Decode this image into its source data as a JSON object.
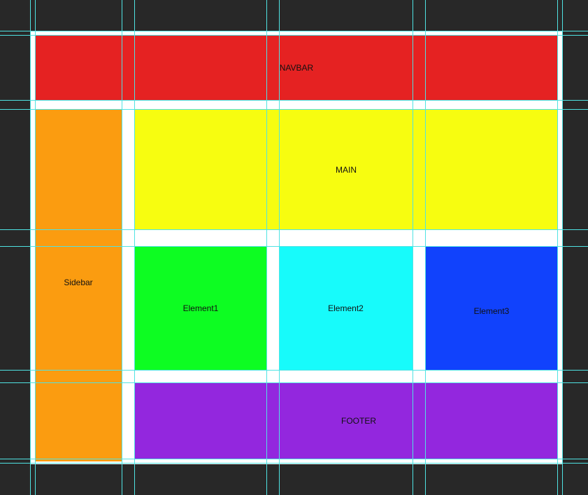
{
  "layout": {
    "navbar": {
      "label": "NAVBAR",
      "color": "#e52222"
    },
    "sidebar": {
      "label": "Sidebar",
      "color": "#fb9c10"
    },
    "main": {
      "label": "MAIN",
      "color": "#f7fd10"
    },
    "elements": [
      {
        "label": "Element1",
        "color": "#0dfd22"
      },
      {
        "label": "Element2",
        "color": "#17fbfb"
      },
      {
        "label": "Element3",
        "color": "#1142fc"
      }
    ],
    "footer": {
      "label": "FOOTER",
      "color": "#9327de"
    }
  },
  "colors": {
    "background": "#282828",
    "canvas": "#ffffff",
    "guides": "#4fe3e3"
  }
}
